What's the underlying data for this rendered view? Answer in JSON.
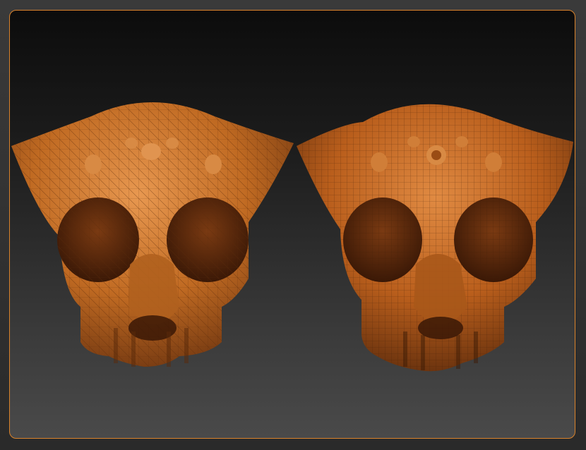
{
  "viewport": {
    "accent_color": "#d9822b",
    "background_top": "#0c0c0c",
    "background_bottom": "#4a4a4a"
  },
  "models": [
    {
      "name": "skull-model-left",
      "topology": "triangulated-mesh",
      "material_color": "#c06a22"
    },
    {
      "name": "skull-model-right",
      "topology": "quad-retopology-mesh",
      "material_color": "#b95e1c"
    }
  ]
}
